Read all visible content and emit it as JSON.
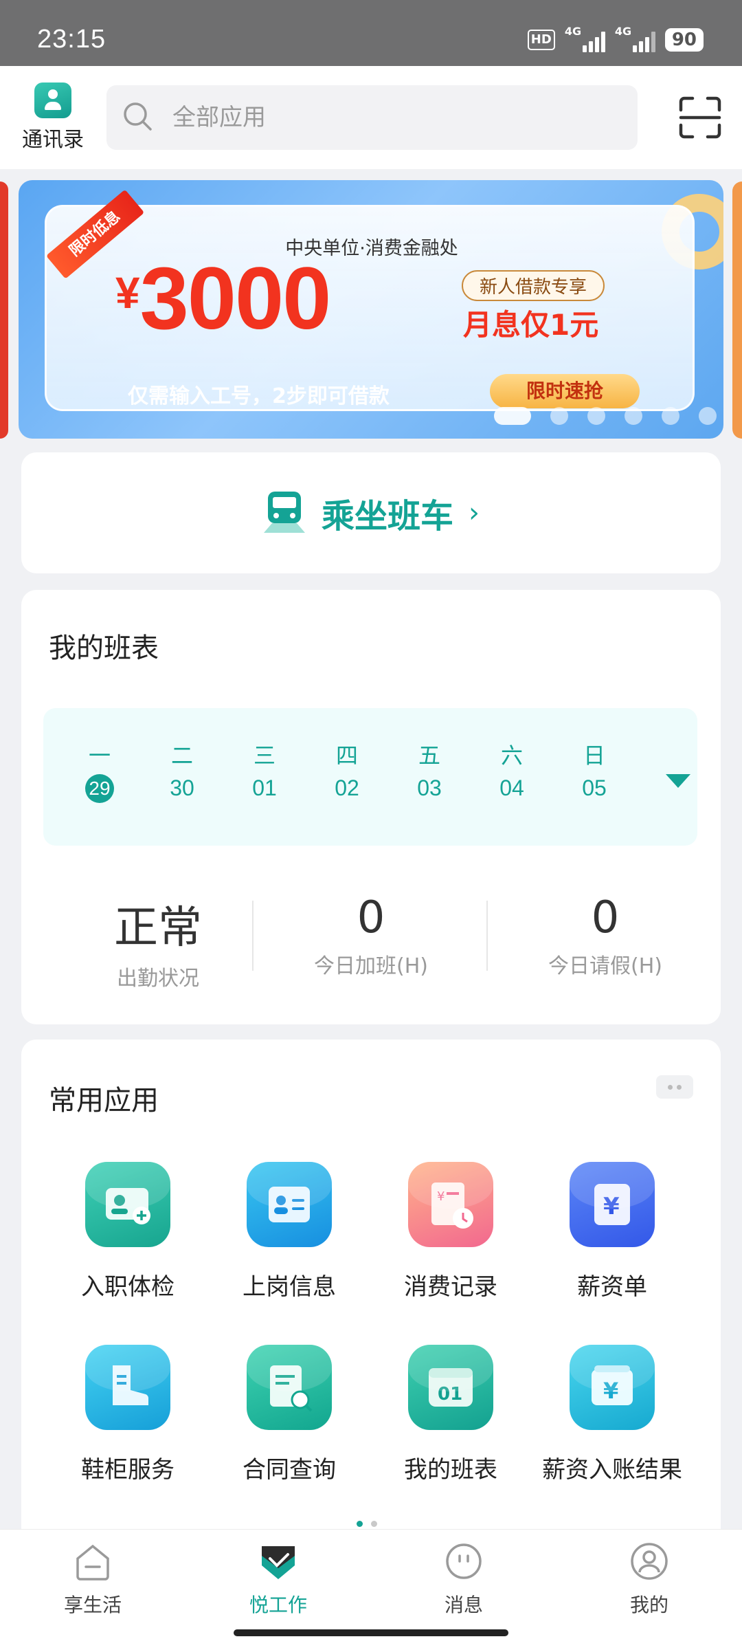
{
  "status_bar": {
    "time": "23:15",
    "hd": "HD",
    "network_1": "4G",
    "network_2": "4G",
    "battery": "90"
  },
  "header": {
    "contacts_label": "通讯录",
    "search_placeholder": "全部应用"
  },
  "banner": {
    "ribbon": "限时低息",
    "subtitle": "中央单位·消费金融处",
    "currency": "¥",
    "amount": "3000",
    "tag": "新人借款专享",
    "rate": "月息仅1元",
    "description": "仅需输入工号，2步即可借款",
    "cta": "限时速抢",
    "page_count": 6,
    "active_page": 1
  },
  "shuttle": {
    "label": "乘坐班车",
    "chevron": "›"
  },
  "schedule": {
    "title": "我的班表",
    "days": [
      {
        "name": "一",
        "date": "29",
        "today": true
      },
      {
        "name": "二",
        "date": "30",
        "today": false
      },
      {
        "name": "三",
        "date": "01",
        "today": false
      },
      {
        "name": "四",
        "date": "02",
        "today": false
      },
      {
        "name": "五",
        "date": "03",
        "today": false
      },
      {
        "name": "六",
        "date": "04",
        "today": false
      },
      {
        "name": "日",
        "date": "05",
        "today": false
      }
    ],
    "stats": [
      {
        "value": "正常",
        "label": "出勤状况"
      },
      {
        "value": "0",
        "label": "今日加班(H)"
      },
      {
        "value": "0",
        "label": "今日请假(H)"
      }
    ]
  },
  "apps": {
    "title": "常用应用",
    "items": [
      {
        "label": "入职体检",
        "icon": "medical-check-icon",
        "color": "#22b8a0"
      },
      {
        "label": "上岗信息",
        "icon": "id-card-icon",
        "color": "#1f9de8"
      },
      {
        "label": "消费记录",
        "icon": "receipt-clock-icon",
        "color": "#f47a7a"
      },
      {
        "label": "薪资单",
        "icon": "yen-card-icon",
        "color": "#3f6ef2"
      },
      {
        "label": "鞋柜服务",
        "icon": "boot-icon",
        "color": "#22b4e8"
      },
      {
        "label": "合同查询",
        "icon": "document-search-icon",
        "color": "#1fb59d"
      },
      {
        "label": "我的班表",
        "icon": "calendar-icon",
        "color": "#22b59b"
      },
      {
        "label": "薪资入账结果",
        "icon": "yen-box-icon",
        "color": "#24b8d8"
      }
    ]
  },
  "tabbar": {
    "items": [
      {
        "label": "享生活",
        "icon": "home-icon",
        "active": false
      },
      {
        "label": "悦工作",
        "icon": "work-shield-icon",
        "active": true
      },
      {
        "label": "消息",
        "icon": "message-icon",
        "active": false
      },
      {
        "label": "我的",
        "icon": "profile-icon",
        "active": false
      }
    ]
  },
  "colors": {
    "accent": "#14a395",
    "banner_red": "#f2331f"
  }
}
